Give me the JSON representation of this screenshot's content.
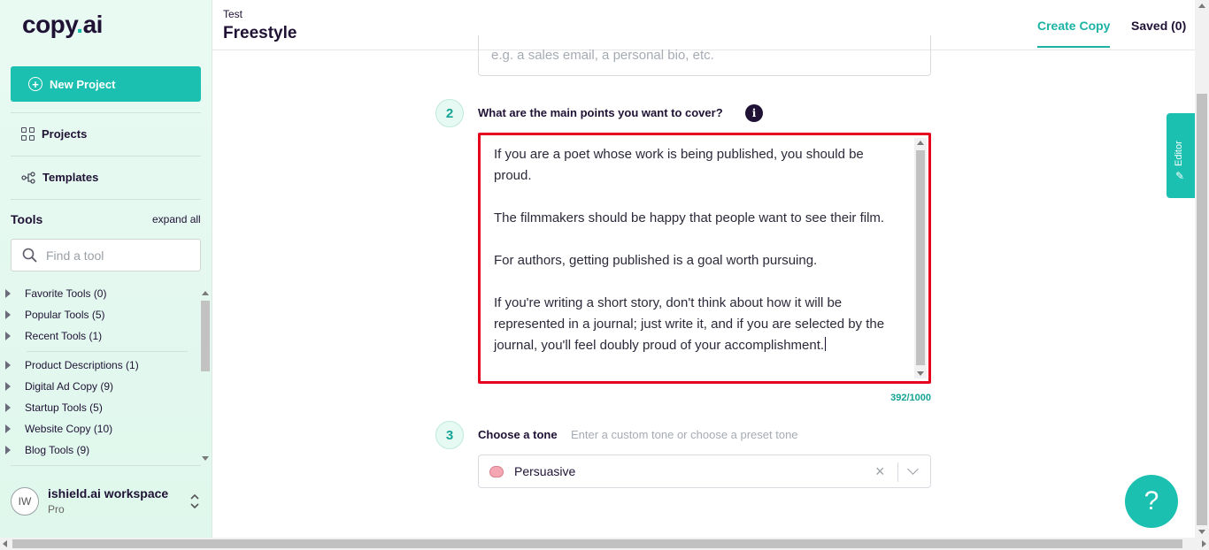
{
  "app": {
    "logo_main": "copy",
    "logo_dot": ".",
    "logo_end": "ai"
  },
  "sidebar": {
    "new_project": "New Project",
    "nav": [
      {
        "label": "Projects"
      },
      {
        "label": "Templates"
      }
    ],
    "tools_title": "Tools",
    "expand_all": "expand all",
    "search_placeholder": "Find a tool",
    "groups_top": [
      "Favorite Tools (0)",
      "Popular Tools (5)",
      "Recent Tools (1)"
    ],
    "groups_bottom": [
      "Product Descriptions (1)",
      "Digital Ad Copy (9)",
      "Startup Tools (5)",
      "Website Copy (10)",
      "Blog Tools (9)"
    ],
    "workspace": {
      "initials": "IW",
      "name": "ishield.ai workspace",
      "plan": "Pro"
    }
  },
  "header": {
    "breadcrumb": "Test",
    "title": "Freestyle",
    "tabs": [
      {
        "label": "Create Copy",
        "active": true
      },
      {
        "label": "Saved (0)",
        "active": false
      }
    ]
  },
  "form": {
    "step1_placeholder": "e.g. a sales email, a personal bio, etc.",
    "step2": {
      "number": "2",
      "label": "What are the main points you want to cover?",
      "info_icon": "i",
      "paragraphs": [
        "If you are a poet whose work is being published, you should be proud.",
        "The filmmakers should be happy that people want to see their film.",
        "For authors, getting published is a goal worth pursuing.",
        "If you're writing a short story, don't think about how it will be represented in a journal; just write it, and if you are selected by the journal, you'll feel doubly proud of your accomplishment."
      ],
      "char_count": "392/1000"
    },
    "step3": {
      "number": "3",
      "label": "Choose a tone",
      "hint": "Enter a custom tone or choose a preset tone",
      "value": "Persuasive",
      "clear": "×"
    }
  },
  "editor_tab": {
    "label": "Editor",
    "icon": "✎"
  },
  "help": {
    "label": "?"
  },
  "colors": {
    "accent": "#1cc0b0",
    "highlight": "#e5001e",
    "text": "#1f1235"
  }
}
